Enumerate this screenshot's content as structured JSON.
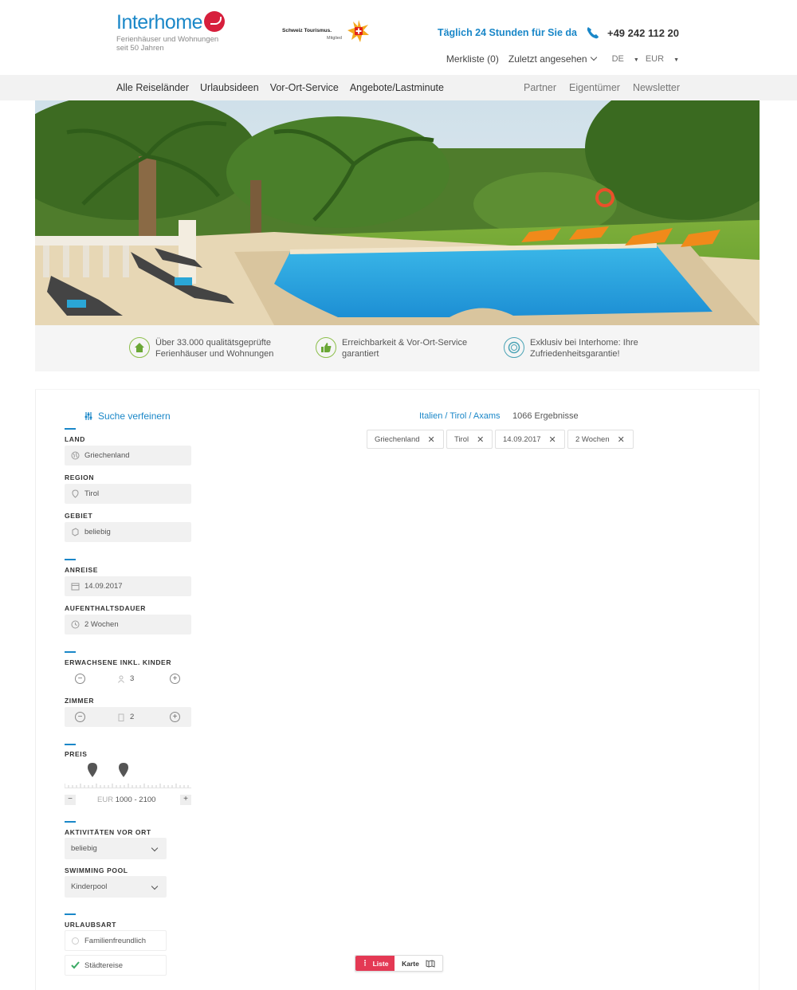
{
  "brand": {
    "name": "Interhome",
    "tagline_1": "Ferienhäuser und Wohnungen",
    "tagline_2": "seit 50 Jahren",
    "partner_name": "Schweiz Tourismus.",
    "partner_sub": "Mitglied"
  },
  "header": {
    "hotline_label": "Täglich 24 Stunden für Sie da",
    "phone": "+49 242 112 20",
    "watchlist": "Merkliste (0)",
    "recently_viewed": "Zuletzt angesehen",
    "language": "DE",
    "currency": "EUR"
  },
  "nav": {
    "left": [
      "Alle Reiseländer",
      "Urlaubsideen",
      "Vor-Ort-Service",
      "Angebote/Lastminute"
    ],
    "right": [
      "Partner",
      "Eigentümer",
      "Newsletter"
    ]
  },
  "usps": [
    {
      "line1": "Über 33.000 qualitätsgeprüfte",
      "line2": "Ferienhäuser und Wohnungen",
      "icon": "house-icon"
    },
    {
      "line1": "Erreichbarkeit & Vor-Ort-Service",
      "line2": "garantiert",
      "icon": "thumbs-up-icon"
    },
    {
      "line1": "Exklusiv bei Interhome: Ihre",
      "line2": "Zufriedenheitsgarantie!",
      "icon": "guarantee-seal-icon"
    }
  ],
  "filters": {
    "refine_label": "Suche verfeinern",
    "land_label": "LAND",
    "land_value": "Griechenland",
    "region_label": "REGION",
    "region_value": "Tirol",
    "gebiet_label": "GEBIET",
    "gebiet_value": "beliebig",
    "anreise_label": "ANREISE",
    "anreise_value": "14.09.2017",
    "dauer_label": "AUFENTHALTSDAUER",
    "dauer_value": "2 Wochen",
    "adults_label": "ERWACHSENE INKL. KINDER",
    "adults_value": "3",
    "rooms_label": "ZIMMER",
    "rooms_value": "2",
    "price_label": "PREIS",
    "price_currency": "EUR",
    "price_range": "1000 - 2100",
    "price_min": 1000,
    "price_max": 2100,
    "activities_label": "AKTIVITÄTEN VOR ORT",
    "activities_value": "beliebig",
    "pool_label": "SWIMMING POOL",
    "pool_value": "Kinderpool",
    "type_label": "URLAUBSART",
    "type_options": [
      {
        "label": "Familienfreundlich",
        "checked": false
      },
      {
        "label": "Städtereise",
        "checked": true
      }
    ]
  },
  "results": {
    "breadcrumb": "Italien / Tirol / Axams",
    "count": "1066 Ergebnisse",
    "chips": [
      "Griechenland",
      "Tirol",
      "14.09.2017",
      "2 Wochen"
    ]
  },
  "view_toggle": {
    "list": "Liste",
    "map": "Karte"
  },
  "colors": {
    "brand_blue": "#1a87c8",
    "brand_red": "#e43954",
    "usp_green": "#8cbf4a"
  }
}
